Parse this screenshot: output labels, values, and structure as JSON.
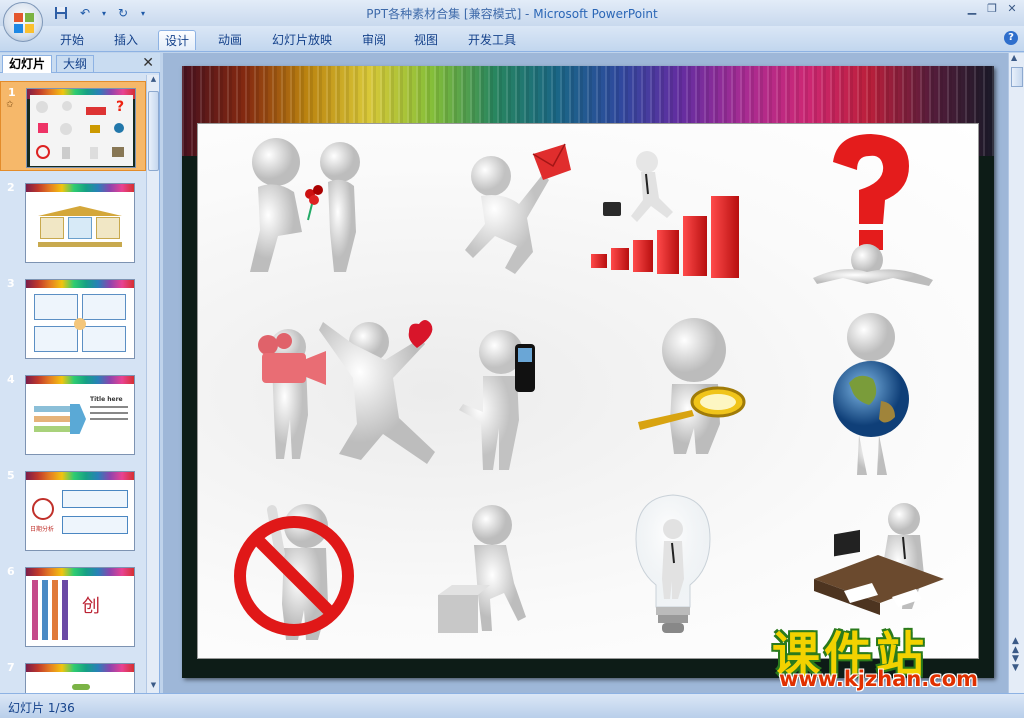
{
  "window": {
    "title_doc": "PPT各种素材合集 [兼容模式] - ",
    "title_app": "Microsoft PowerPoint"
  },
  "ribbon": {
    "tabs": [
      {
        "label": "开始"
      },
      {
        "label": "插入"
      },
      {
        "label": "设计"
      },
      {
        "label": "动画"
      },
      {
        "label": "幻灯片放映"
      },
      {
        "label": "审阅"
      },
      {
        "label": "视图"
      },
      {
        "label": "开发工具"
      }
    ],
    "active_tab": "设计"
  },
  "left_pane": {
    "tab_slides": "幻灯片",
    "tab_outline": "大纲",
    "slides": [
      {
        "number": "1",
        "selected": true
      },
      {
        "number": "2"
      },
      {
        "number": "3"
      },
      {
        "number": "4"
      },
      {
        "number": "5"
      },
      {
        "number": "6"
      },
      {
        "number": "7"
      }
    ],
    "thumb4_title": "Title here",
    "thumb5_label": "日期分析"
  },
  "slide": {
    "watermark_cn": "课件站",
    "watermark_url": "www.kjzhan.com"
  },
  "status": {
    "slide_indicator": "幻灯片 1/36"
  },
  "colors": {
    "ribbon_text": "#15428b",
    "selected_thumb": "#f6b86a",
    "watermark_yellow": "#f2d200",
    "watermark_red": "#e03000"
  }
}
